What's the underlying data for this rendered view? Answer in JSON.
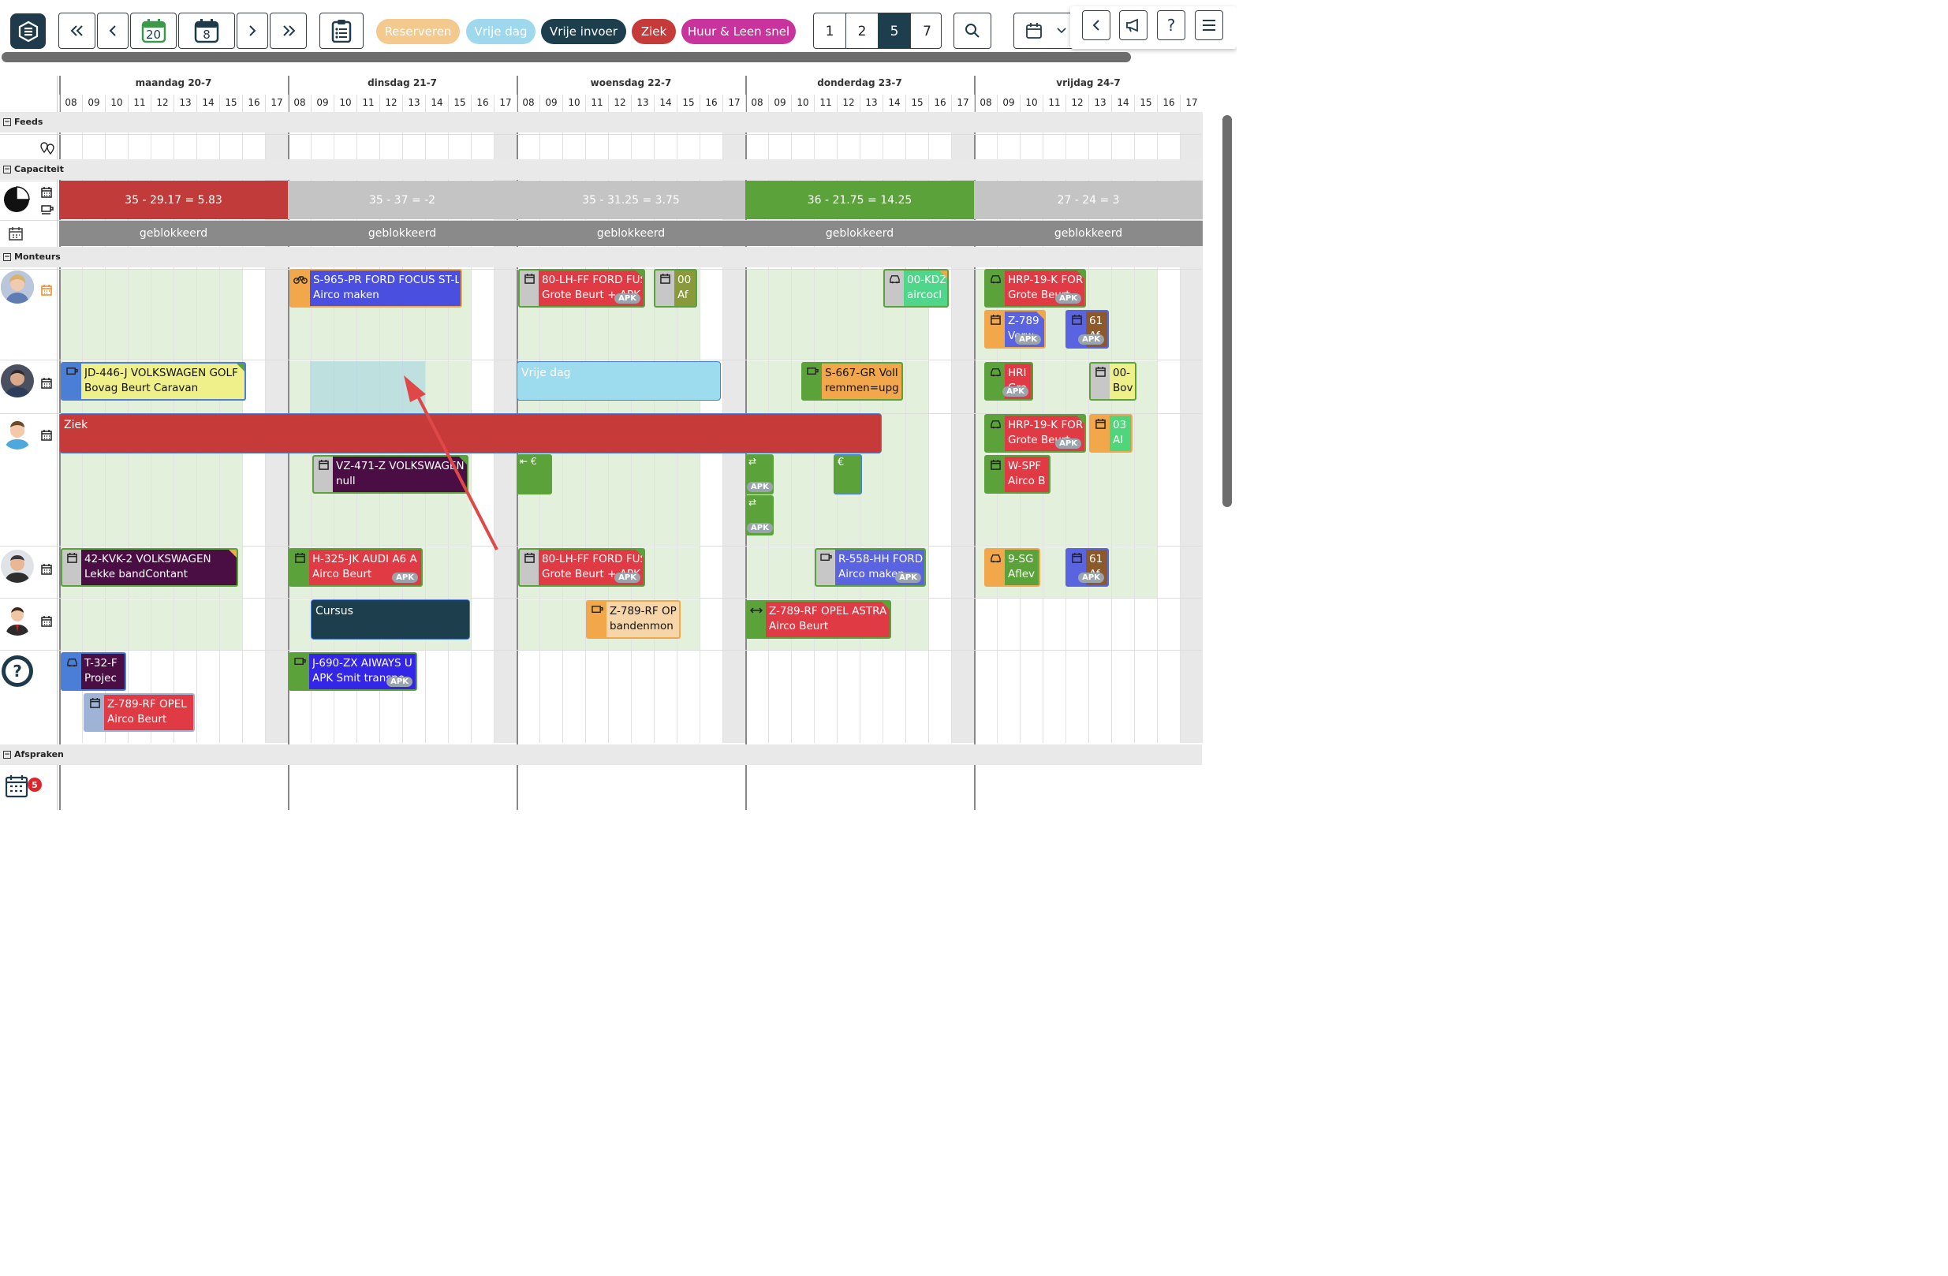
{
  "toolbar": {
    "date_today": "20",
    "date_week": "8",
    "pills": [
      {
        "label": "Reserveren",
        "color": "#f3c98d"
      },
      {
        "label": "Vrije dag",
        "color": "#9ed8ec"
      },
      {
        "label": "Vrije invoer",
        "color": "#1d3e4d"
      },
      {
        "label": "Ziek",
        "color": "#c63a3a"
      },
      {
        "label": "Huur & Leen snel",
        "color": "#c8349b"
      }
    ],
    "day_counts": [
      "1",
      "2",
      "5",
      "7"
    ],
    "active_day_count": "5"
  },
  "days": [
    {
      "label": "maandag 20-7"
    },
    {
      "label": "dinsdag 21-7"
    },
    {
      "label": "woensdag 22-7"
    },
    {
      "label": "donderdag 23-7"
    },
    {
      "label": "vrijdag 24-7"
    }
  ],
  "hours": [
    "08",
    "09",
    "10",
    "11",
    "12",
    "13",
    "14",
    "15",
    "16",
    "17"
  ],
  "sections": {
    "feeds": "Feeds",
    "capacity": "Capaciteit",
    "mechanics": "Monteurs",
    "appointments": "Afspraken"
  },
  "capacity": [
    {
      "text": "35 - 29.17 = 5.83",
      "color": "#c23b3b"
    },
    {
      "text": "35 - 37 = -2",
      "color": "#c4c4c4"
    },
    {
      "text": "35 - 31.25 = 3.75",
      "color": "#c4c4c4"
    },
    {
      "text": "36 - 21.75 = 14.25",
      "color": "#5ba23a"
    },
    {
      "text": "27 - 24 = 3",
      "color": "#c4c4c4"
    }
  ],
  "blocked_label": "geblokkeerd",
  "appointments_badge": "5",
  "cards": [
    {
      "id": "c1",
      "l1": "S-965-PR FORD FOCUS ST-Li",
      "l2": "Airco maken",
      "bg": "#4b4fe0",
      "strip": "#f2a84a",
      "icon": "bike-icon",
      "apk": false,
      "corner": ""
    },
    {
      "id": "c2",
      "l1": "80-LH-FF FORD FUS",
      "l2": "Grote Beurt + APK",
      "bg": "#e03a44",
      "strip": "#c7c7c7",
      "icon": "calendar-icon",
      "apk": true,
      "corner": "#5ba23a"
    },
    {
      "id": "c3",
      "l1": "00",
      "l2": "Af",
      "bg": "#8a9a3a",
      "strip": "#c7c7c7",
      "icon": "calendar-icon",
      "apk": false,
      "corner": ""
    },
    {
      "id": "c4",
      "l1": "00-KDZ",
      "l2": "aircocl",
      "bg": "#4fd68b",
      "strip": "#c7c7c7",
      "icon": "car-icon",
      "apk": false,
      "corner": "#f2a84a"
    },
    {
      "id": "c5",
      "l1": "HRP-19-K FOR",
      "l2": "Grote Beurt",
      "bg": "#e03a44",
      "strip": "#5ba23a",
      "icon": "car-icon",
      "apk": true,
      "corner": "#5ba23a"
    },
    {
      "id": "c6",
      "l1": "Z-789",
      "l2": "Verw",
      "bg": "#5a63e0",
      "strip": "#f2a84a",
      "icon": "calendar-icon",
      "apk": true,
      "corner": "#f2a84a"
    },
    {
      "id": "c7",
      "l1": "61",
      "l2": "Af",
      "bg": "#8c5a2a",
      "strip": "#5a63e0",
      "icon": "calendar-icon",
      "apk": true,
      "corner": ""
    },
    {
      "id": "c8",
      "l1": "JD-446-J VOLKSWAGEN GOLF",
      "l2": "Bovag Beurt Caravan",
      "bg": "#f0f08a",
      "strip": "#4b7ed6",
      "icon": "coffee-icon",
      "apk": false,
      "corner": "#5ba23a",
      "dark": true
    },
    {
      "id": "c9",
      "l1": "S-667-GR Voll",
      "l2": "remmen=upg",
      "bg": "#f2a84a",
      "strip": "#5ba23a",
      "icon": "coffee-icon",
      "apk": false,
      "corner": "",
      "dark": true
    },
    {
      "id": "c10",
      "l1": "HRI",
      "l2": "Gro",
      "bg": "#e03a44",
      "strip": "#5ba23a",
      "icon": "car-icon",
      "apk": true,
      "corner": ""
    },
    {
      "id": "c11",
      "l1": "00-",
      "l2": "Bov",
      "bg": "#f0f08a",
      "strip": "#c7c7c7",
      "icon": "calendar-icon",
      "apk": false,
      "corner": "",
      "dark": true
    },
    {
      "id": "c12",
      "l1": "HRP-19-K FOR",
      "l2": "Grote Beurt",
      "bg": "#e03a44",
      "strip": "#5ba23a",
      "icon": "car-icon",
      "apk": true,
      "corner": "#5ba23a"
    },
    {
      "id": "c13",
      "l1": "03",
      "l2": "Al",
      "bg": "#4fd67a",
      "strip": "#f2a84a",
      "icon": "calendar-icon",
      "apk": false,
      "corner": ""
    },
    {
      "id": "c14",
      "l1": "VZ-471-Z VOLKSWAGEN",
      "l2": "null",
      "bg": "#4a0e45",
      "strip": "#c7c7c7",
      "icon": "calendar-icon",
      "apk": false,
      "corner": "#5ba23a"
    },
    {
      "id": "c15",
      "l1": "W-SPF",
      "l2": "Airco B",
      "bg": "#e03a44",
      "strip": "#5ba23a",
      "icon": "calendar-icon",
      "apk": false,
      "corner": ""
    },
    {
      "id": "c16",
      "l1": "42-KVK-2 VOLKSWAGEN",
      "l2": "Lekke bandContant",
      "bg": "#4a0e45",
      "strip": "#c7c7c7",
      "icon": "calendar-icon",
      "apk": false,
      "corner": "#f2a84a"
    },
    {
      "id": "c17",
      "l1": "H-325-JK AUDI A6 A",
      "l2": "Airco Beurt",
      "bg": "#e03a44",
      "strip": "#5ba23a",
      "icon": "calendar-icon",
      "apk": true,
      "corner": ""
    },
    {
      "id": "c18",
      "l1": "80-LH-FF FORD FUS",
      "l2": "Grote Beurt + APK",
      "bg": "#e03a44",
      "strip": "#c7c7c7",
      "icon": "calendar-icon",
      "apk": true,
      "corner": "#5ba23a"
    },
    {
      "id": "c19",
      "l1": "R-558-HH FORD",
      "l2": "Airco maken",
      "bg": "#5a63e0",
      "strip": "#c7c7c7",
      "icon": "coffee-icon",
      "apk": true,
      "corner": ""
    },
    {
      "id": "c20",
      "l1": "9-SG",
      "l2": "Aflev",
      "bg": "#5ba23a",
      "strip": "#f2a84a",
      "icon": "car-icon",
      "apk": false,
      "corner": ""
    },
    {
      "id": "c21",
      "l1": "61",
      "l2": "Af",
      "bg": "#8c5a2a",
      "strip": "#5a63e0",
      "icon": "calendar-icon",
      "apk": true,
      "corner": ""
    },
    {
      "id": "c22",
      "l1": "Z-789-RF OP",
      "l2": "bandenmon",
      "bg": "#f6d6a8",
      "strip": "#f2a84a",
      "icon": "coffee-icon",
      "apk": false,
      "corner": "",
      "dark": true
    },
    {
      "id": "c23",
      "l1": "Z-789-RF OPEL ASTRA",
      "l2": "Airco Beurt",
      "bg": "#e03a44",
      "strip": "#5ba23a",
      "icon": "arrows-icon",
      "apk": false,
      "corner": "#5ba23a"
    },
    {
      "id": "c24",
      "l1": "T-32-F",
      "l2": "Projec",
      "bg": "#4a0e45",
      "strip": "#4b7ed6",
      "icon": "car-icon",
      "apk": false,
      "corner": ""
    },
    {
      "id": "c25",
      "l1": "J-690-ZX AIWAYS U",
      "l2": "APK Smit transpo",
      "bg": "#3326e6",
      "strip": "#5ba23a",
      "icon": "coffee-icon",
      "apk": true,
      "corner": ""
    },
    {
      "id": "c26",
      "l1": "Z-789-RF OPEL",
      "l2": "Airco Beurt",
      "bg": "#e03a44",
      "strip": "#9fb3d6",
      "icon": "calendar-icon",
      "apk": false,
      "corner": ""
    }
  ],
  "blocks": {
    "vrije_dag": "Vrije dag",
    "ziek": "Ziek",
    "cursus": "Cursus"
  }
}
